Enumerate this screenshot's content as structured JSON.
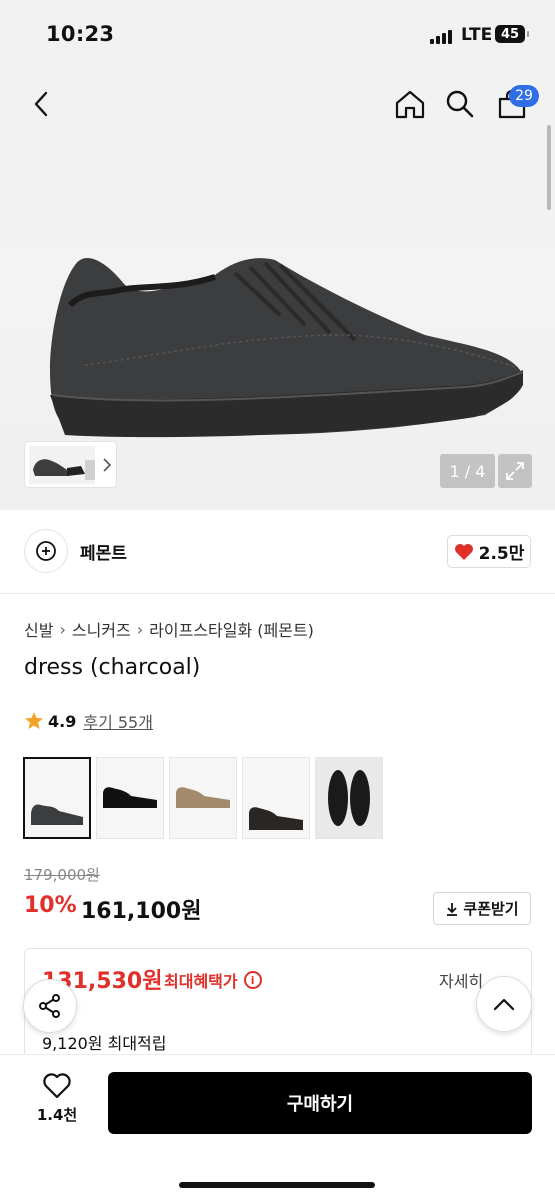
{
  "status_bar": {
    "time": "10:23",
    "network": "LTE",
    "battery": "45"
  },
  "header": {
    "cart_count": "29"
  },
  "gallery": {
    "counter": "1 / 4"
  },
  "brand": {
    "name": "페몬트",
    "likes": "2.5만"
  },
  "breadcrumb": [
    "신발",
    "스니커즈",
    "라이프스타일화 (페몬트)"
  ],
  "product": {
    "title": "dress (charcoal)",
    "rating": "4.9",
    "reviews": "후기 55개",
    "swatches": [
      "charcoal",
      "black",
      "beige",
      "dark-brown",
      "black-leather"
    ],
    "original_price": "179,000원",
    "discount": "10%",
    "price": "161,100원"
  },
  "coupon": {
    "label": "쿠폰받기"
  },
  "benefit": {
    "best_price": "131,530원",
    "best_label": "최대혜택가",
    "detail": "자세히",
    "points": "9,120원 최대적립"
  },
  "bottom": {
    "wish_count": "1.4천",
    "buy_label": "구매하기"
  },
  "colors": {
    "accent_red": "#e1302a",
    "badge_blue": "#2f6ee6",
    "buy_bg": "#000000"
  }
}
